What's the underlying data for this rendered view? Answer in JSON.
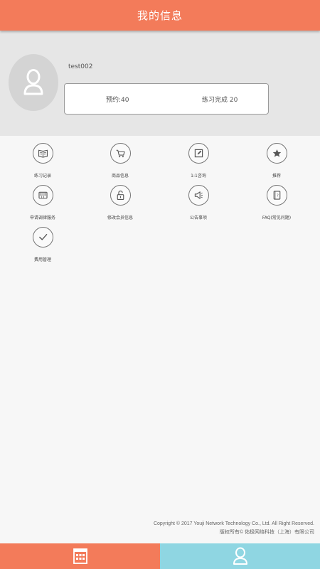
{
  "header": {
    "title": "我的信息"
  },
  "profile": {
    "username": "test002",
    "reservations_label": "预约:40",
    "completed_label": "练习完成 20"
  },
  "menu": {
    "items": [
      {
        "label": "练习记录",
        "icon": "book-icon"
      },
      {
        "label": "商品信息",
        "icon": "cart-icon"
      },
      {
        "label": "1:1咨询",
        "icon": "edit-icon"
      },
      {
        "label": "推荐",
        "icon": "star-icon"
      },
      {
        "label": "申请调律服务",
        "icon": "piano-icon"
      },
      {
        "label": "修改会员信息",
        "icon": "lock-icon"
      },
      {
        "label": "公告事项",
        "icon": "megaphone-icon"
      },
      {
        "label": "FAQ(常见问题)",
        "icon": "faq-icon"
      },
      {
        "label": "费用管理",
        "icon": "check-icon"
      }
    ]
  },
  "footer": {
    "copyright_en": "Copyright © 2017 Youji Network Technology Co., Ltd. All Right Reserved.",
    "copyright_cn": "版权所有© 佑极网络科技（上海）有限公司"
  },
  "tabbar": {
    "tabs": [
      {
        "icon": "calendar-icon",
        "color": "#f37b5a"
      },
      {
        "icon": "user-icon",
        "color": "#8fd6e2"
      }
    ]
  },
  "colors": {
    "accent": "#f37b5a",
    "tab_active": "#8fd6e2"
  }
}
